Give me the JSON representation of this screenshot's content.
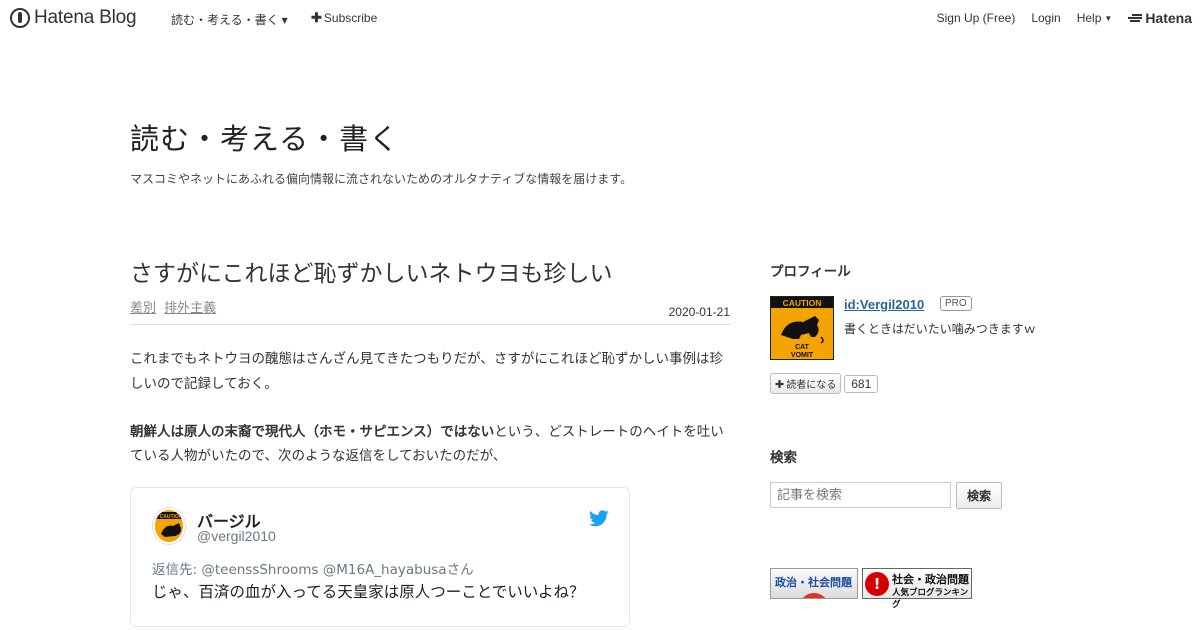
{
  "global_header": {
    "logo_text": "Hatena Blog",
    "blog_menu_label": "読む・考える・書く",
    "subscribe_label": "Subscribe",
    "signup_label": "Sign Up (Free)",
    "login_label": "Login",
    "help_label": "Help",
    "hatena_label": "Hatena"
  },
  "blog": {
    "title": "読む・考える・書く",
    "description": "マスコミやネットにあふれる偏向情報に流されないためのオルタナティブな情報を届けます。"
  },
  "entry": {
    "title": "さすがにこれほど恥ずかしいネトウヨも珍しい",
    "categories": [
      "差別",
      "排外主義"
    ],
    "date": "2020-01-21",
    "paragraph1": "これまでもネトウヨの醜態はさんざん見てきたつもりだが、さすがにこれほど恥ずかしい事例は珍しいので記録しておく。",
    "paragraph2_bold": "朝鮮人は原人の末裔で現代人（ホモ・サピエンス）ではない",
    "paragraph2_rest": "という、どストレートのヘイトを吐いている人物がいたので、次のような返信をしておいたのだが、"
  },
  "tweet": {
    "avatar_label": "CAUTION",
    "name": "バージル",
    "handle": "@vergil2010",
    "reply_to": "返信先: @teenssShrooms @M16A_hayabusaさん",
    "text": "じゃ、百済の血が入ってる天皇家は原人つーことでいいよね？",
    "brand_color": "#1da1f2"
  },
  "sidebar": {
    "profile": {
      "title": "プロフィール",
      "icon_caution": "CAUTION",
      "icon_text": "CAT VOMIT",
      "id_label": "id:Vergil2010",
      "badge": "PRO",
      "description": "書くときはだいたい噛みつきますｗ",
      "reader_button": "読者になる",
      "reader_count": "681"
    },
    "search": {
      "title": "検索",
      "placeholder": "記事を検索",
      "button": "検索"
    },
    "banners": {
      "banner1": "政治・社会問題",
      "banner2_line1": "社会・政治問題",
      "banner2_line2": "人気ブログランキング"
    }
  }
}
